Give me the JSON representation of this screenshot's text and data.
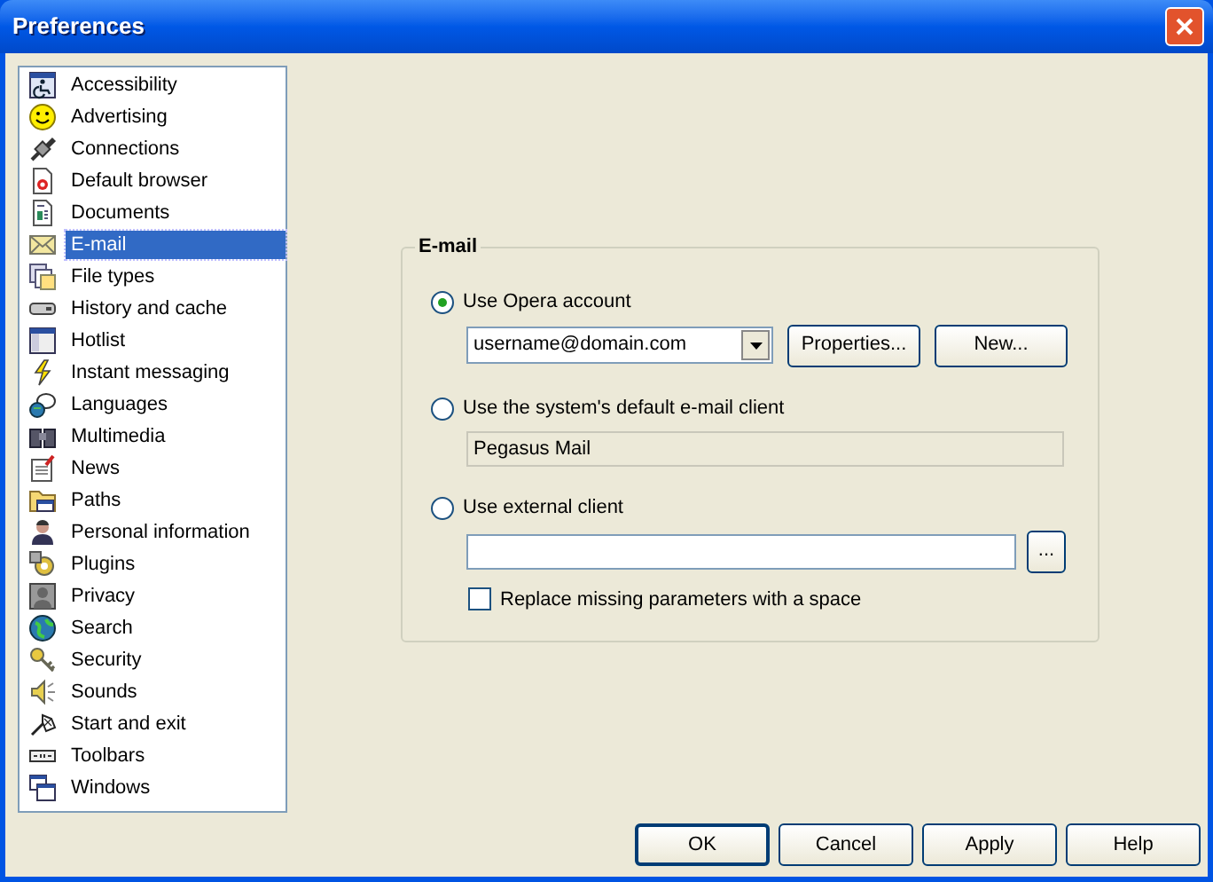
{
  "window": {
    "title": "Preferences"
  },
  "sidebar": {
    "items": [
      {
        "label": "Accessibility",
        "selected": false
      },
      {
        "label": "Advertising",
        "selected": false
      },
      {
        "label": "Connections",
        "selected": false
      },
      {
        "label": "Default browser",
        "selected": false
      },
      {
        "label": "Documents",
        "selected": false
      },
      {
        "label": "E-mail",
        "selected": true
      },
      {
        "label": "File types",
        "selected": false
      },
      {
        "label": "History and cache",
        "selected": false
      },
      {
        "label": "Hotlist",
        "selected": false
      },
      {
        "label": "Instant messaging",
        "selected": false
      },
      {
        "label": "Languages",
        "selected": false
      },
      {
        "label": "Multimedia",
        "selected": false
      },
      {
        "label": "News",
        "selected": false
      },
      {
        "label": "Paths",
        "selected": false
      },
      {
        "label": "Personal information",
        "selected": false
      },
      {
        "label": "Plugins",
        "selected": false
      },
      {
        "label": "Privacy",
        "selected": false
      },
      {
        "label": "Search",
        "selected": false
      },
      {
        "label": "Security",
        "selected": false
      },
      {
        "label": "Sounds",
        "selected": false
      },
      {
        "label": "Start and exit",
        "selected": false
      },
      {
        "label": "Toolbars",
        "selected": false
      },
      {
        "label": "Windows",
        "selected": false
      }
    ]
  },
  "email_group": {
    "title": "E-mail",
    "options": [
      {
        "kind": "account",
        "label": "Use Opera account",
        "selected": true,
        "account": "username@domain.com",
        "buttons": [
          "Properties...",
          "New..."
        ]
      },
      {
        "kind": "system",
        "label": "Use the system's default e-mail client",
        "selected": false,
        "client": "Pegasus Mail"
      },
      {
        "kind": "external",
        "label": "Use external client",
        "selected": false,
        "browse_button": "...",
        "checkbox": {
          "label": "Replace missing parameters with a space",
          "checked": false
        }
      }
    ]
  },
  "buttons": [
    "OK",
    "Cancel",
    "Apply",
    "Help"
  ]
}
